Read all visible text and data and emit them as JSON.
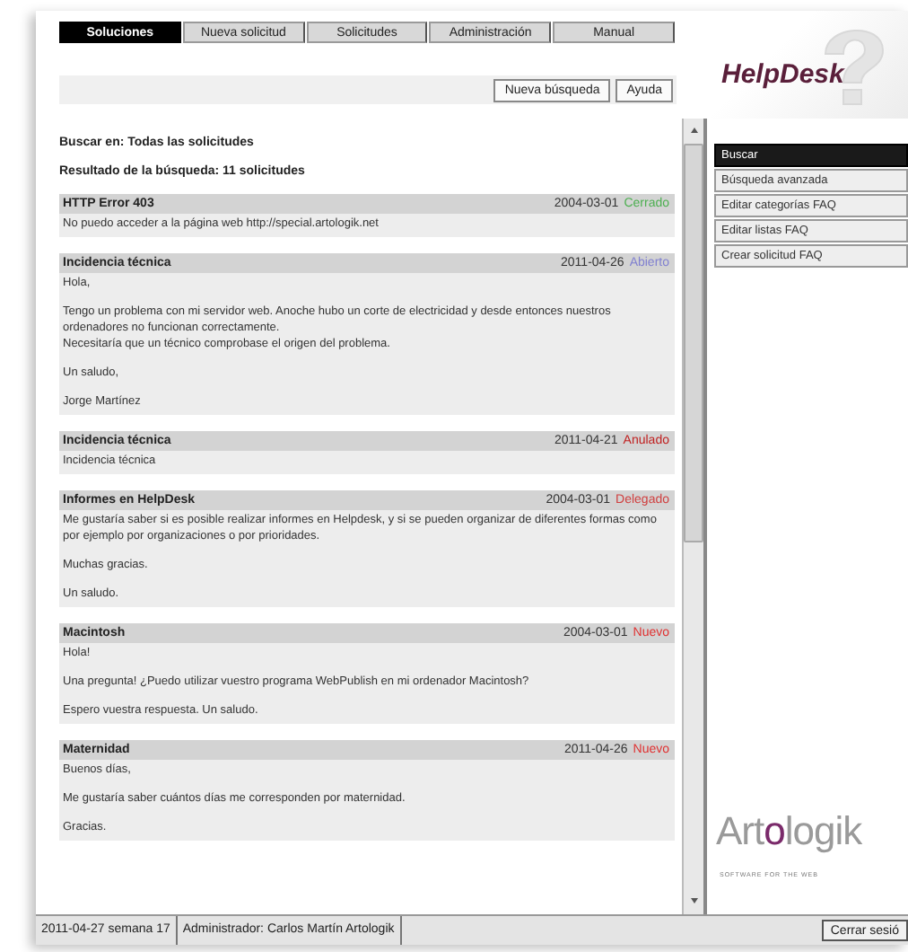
{
  "tabs": [
    {
      "label": "Soluciones",
      "selected": true
    },
    {
      "label": "Nueva solicitud",
      "selected": false
    },
    {
      "label": "Solicitudes",
      "selected": false
    },
    {
      "label": "Administración",
      "selected": false
    },
    {
      "label": "Manual",
      "selected": false
    }
  ],
  "toolbar": {
    "buttons": [
      "Nueva búsqueda",
      "Ayuda"
    ]
  },
  "search_scope": "Buscar en: Todas las solicitudes",
  "result_count": "Resultado de la búsqueda: 11 solicitudes",
  "results": [
    {
      "title": "HTTP Error 403",
      "date": "2004-03-01",
      "status": "Cerrado",
      "color": "#4caf50",
      "paragraphs": [
        [
          "No puedo acceder a la página web http://special.artologik.net"
        ]
      ]
    },
    {
      "title": "Incidencia técnica",
      "date": "2011-04-26",
      "status": "Abierto",
      "color": "#8080d0",
      "paragraphs": [
        [
          "Hola,"
        ],
        [
          "Tengo un problema con mi servidor web. Anoche hubo un corte de electricidad y desde entonces nuestros ordenadores no funcionan correctamente.",
          "Necesitaría que un técnico comprobase el origen del problema."
        ],
        [
          "Un saludo,"
        ],
        [
          "Jorge Martínez"
        ]
      ]
    },
    {
      "title": "Incidencia técnica",
      "date": "2011-04-21",
      "status": "Anulado",
      "color": "#c02020",
      "paragraphs": [
        [
          "Incidencia técnica"
        ]
      ]
    },
    {
      "title": "Informes en HelpDesk",
      "date": "2004-03-01",
      "status": "Delegado",
      "color": "#d04040",
      "paragraphs": [
        [
          "Me gustaría saber si es posible realizar informes en Helpdesk, y si se pueden organizar de diferentes formas como por ejemplo por organizaciones o por prioridades."
        ],
        [
          "Muchas gracias."
        ],
        [
          "Un saludo."
        ]
      ]
    },
    {
      "title": "Macintosh",
      "date": "2004-03-01",
      "status": "Nuevo",
      "color": "#e03030",
      "paragraphs": [
        [
          "Hola!"
        ],
        [
          "Una pregunta! ¿Puedo utilizar vuestro programa WebPublish en mi ordenador Macintosh?"
        ],
        [
          "Espero vuestra respuesta. Un saludo."
        ]
      ]
    },
    {
      "title": "Maternidad",
      "date": "2011-04-26",
      "status": "Nuevo",
      "color": "#e03030",
      "paragraphs": [
        [
          "Buenos días,"
        ],
        [
          "Me gustaría saber cuántos días me corresponden por maternidad."
        ],
        [
          "Gracias."
        ]
      ]
    }
  ],
  "logo": "HelpDesk",
  "side_menu": [
    {
      "label": "Buscar",
      "selected": true
    },
    {
      "label": "Búsqueda avanzada",
      "selected": false
    },
    {
      "label": "Editar categorías FAQ",
      "selected": false
    },
    {
      "label": "Editar listas FAQ",
      "selected": false
    },
    {
      "label": "Crear solicitud FAQ",
      "selected": false
    }
  ],
  "brand": {
    "parts": [
      "Art",
      "o",
      "logik"
    ],
    "tagline": "SOFTWARE FOR THE WEB"
  },
  "status_bar": {
    "date": "2011-04-27  semana 17",
    "user": "Administrador: Carlos Martín  Artologik",
    "logout": "Cerrar sesió"
  }
}
